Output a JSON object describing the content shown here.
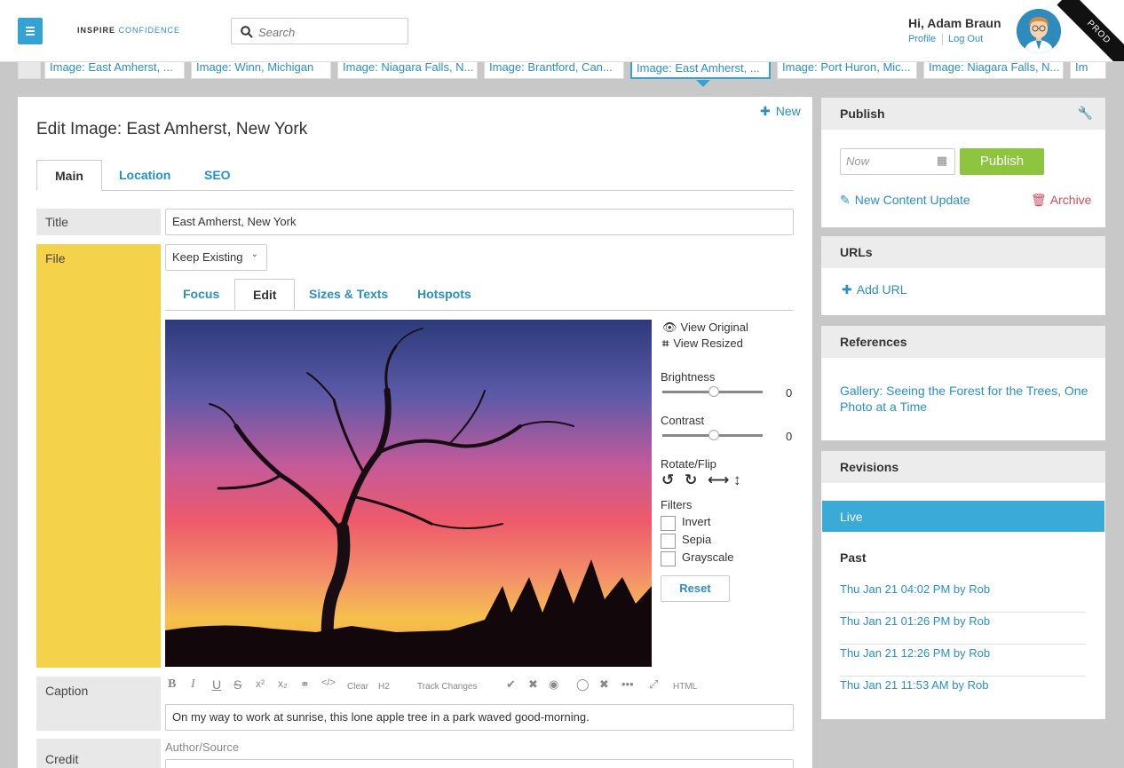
{
  "header": {
    "logo_part1": "INSPIRE ",
    "logo_part2": "CONFIDENCE",
    "search_placeholder": "Search",
    "greeting": "Hi, Adam Braun",
    "profile_link": "Profile",
    "logout_link": "Log Out",
    "env_badge": "PROD"
  },
  "strip_tabs": [
    "Image: East Amherst, ...",
    "Image: Winn, Michigan",
    "Image: Niagara Falls, N...",
    "Image: Brantford, Can...",
    "Image: East Amherst, ...",
    "Image: Port Huron, Mic...",
    "Image: Niagara Falls, N...",
    "Im"
  ],
  "main": {
    "new_label": "New",
    "title": "Edit Image: East Amherst, New York",
    "tabs": [
      "Main",
      "Location",
      "SEO"
    ],
    "title_label": "Title",
    "title_value": "East Amherst, New York",
    "file_label": "File",
    "file_select": "Keep Existing",
    "subtabs": [
      "Focus",
      "Edit",
      "Sizes & Texts",
      "Hotspots"
    ],
    "view_original": "View Original",
    "view_resized": "View Resized",
    "brightness_label": "Brightness",
    "brightness_value": "0",
    "contrast_label": "Contrast",
    "contrast_value": "0",
    "rotate_label": "Rotate/Flip",
    "filters_label": "Filters",
    "filters": [
      "Invert",
      "Sepia",
      "Grayscale"
    ],
    "reset_label": "Reset",
    "caption_label": "Caption",
    "toolbar": {
      "clear": "Clear",
      "h2": "H2",
      "track": "Track Changes",
      "html": "HTML"
    },
    "caption_value": "On my way to work at sunrise, this lone apple tree in a park waved good-morning.",
    "credit_label": "Credit",
    "credit_hint": "Author/Source"
  },
  "publish": {
    "heading": "Publish",
    "date_placeholder": "Now",
    "publish_label": "Publish",
    "new_content_update": "New Content Update",
    "archive": "Archive"
  },
  "urls": {
    "heading": "URLs",
    "add_url": "Add URL"
  },
  "references": {
    "heading": "References",
    "item": "Gallery: Seeing the Forest for the Trees, One Photo at a Time"
  },
  "revisions": {
    "heading": "Revisions",
    "live": "Live",
    "past_heading": "Past",
    "items": [
      "Thu Jan 21 04:02 PM by Rob",
      "Thu Jan 21 01:26 PM by Rob",
      "Thu Jan 21 12:26 PM by Rob",
      "Thu Jan 21 11:53 AM by Rob"
    ]
  },
  "colors": {
    "accent": "#2a8fc7",
    "file_highlight": "#f4d34b",
    "publish_green": "#8ec53e",
    "live_blue": "#3aabd9"
  }
}
